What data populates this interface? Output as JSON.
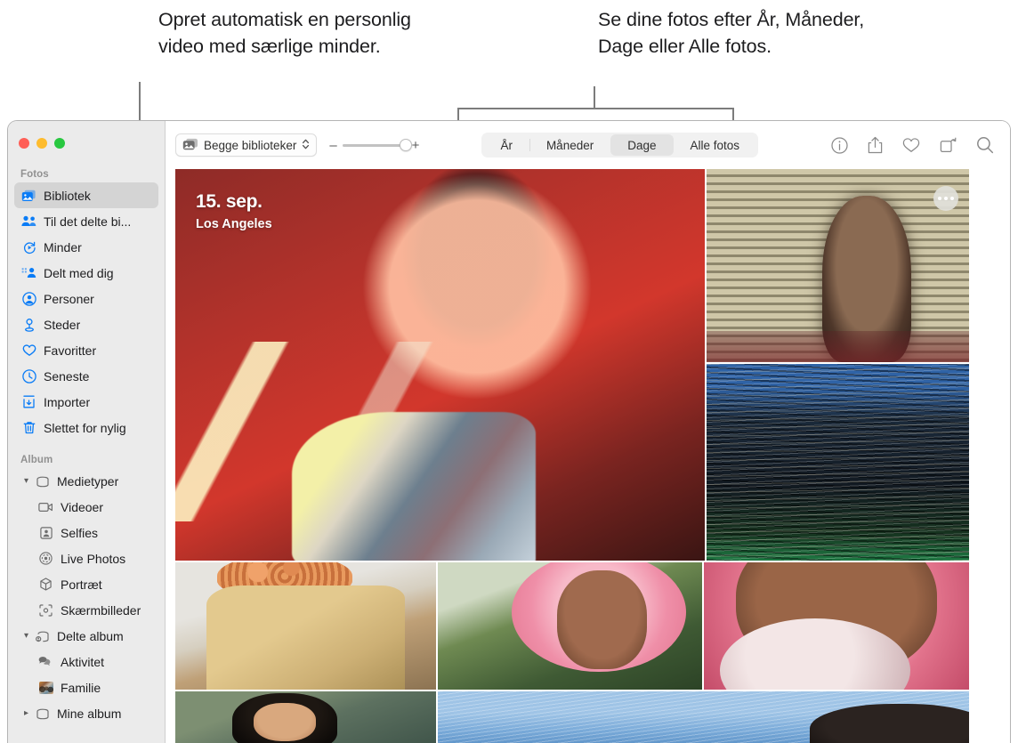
{
  "callouts": {
    "left": "Opret automatisk en personlig video med særlige minder.",
    "right": "Se dine fotos efter År, Måneder, Dage eller Alle fotos."
  },
  "toolbar": {
    "library_button": "Begge biblioteker",
    "zoom_minus": "–",
    "zoom_plus": "+",
    "segments": [
      {
        "label": "År",
        "active": false
      },
      {
        "label": "Måneder",
        "active": false
      },
      {
        "label": "Dage",
        "active": true
      },
      {
        "label": "Alle fotos",
        "active": false
      }
    ],
    "icons": [
      "info-icon",
      "share-icon",
      "heart-icon",
      "rotate-icon",
      "search-icon"
    ]
  },
  "sidebar": {
    "sections": [
      {
        "title": "Fotos",
        "items": [
          {
            "label": "Bibliotek",
            "icon": "library-icon",
            "selected": true
          },
          {
            "label": "Til det delte bi...",
            "icon": "shared-library-icon",
            "selected": false
          },
          {
            "label": "Minder",
            "icon": "memories-icon",
            "selected": false
          },
          {
            "label": "Delt med dig",
            "icon": "shared-with-you-icon",
            "selected": false
          },
          {
            "label": "Personer",
            "icon": "people-icon",
            "selected": false
          },
          {
            "label": "Steder",
            "icon": "places-icon",
            "selected": false
          },
          {
            "label": "Favoritter",
            "icon": "heart-icon",
            "selected": false
          },
          {
            "label": "Seneste",
            "icon": "clock-icon",
            "selected": false
          },
          {
            "label": "Importer",
            "icon": "import-icon",
            "selected": false
          },
          {
            "label": "Slettet for nylig",
            "icon": "trash-icon",
            "selected": false
          }
        ]
      },
      {
        "title": "Album",
        "items": [
          {
            "label": "Medietyper",
            "icon": "folder-icon",
            "disclosure": "open",
            "indent": 0
          },
          {
            "label": "Videoer",
            "icon": "video-icon",
            "indent": 1
          },
          {
            "label": "Selfies",
            "icon": "selfie-icon",
            "indent": 1
          },
          {
            "label": "Live Photos",
            "icon": "live-photo-icon",
            "indent": 1
          },
          {
            "label": "Portræt",
            "icon": "portrait-cube-icon",
            "indent": 1
          },
          {
            "label": "Skærmbilleder",
            "icon": "screenshot-icon",
            "indent": 1
          },
          {
            "label": "Delte album",
            "icon": "shared-folder-icon",
            "disclosure": "open",
            "indent": 0
          },
          {
            "label": "Aktivitet",
            "icon": "activity-icon",
            "indent": 1
          },
          {
            "label": "Familie",
            "icon": "album-thumbnail",
            "indent": 1
          },
          {
            "label": "Mine album",
            "icon": "folder-icon",
            "disclosure": "closed",
            "indent": 0
          }
        ]
      }
    ]
  },
  "grid": {
    "date_overlay": {
      "date": "15. sep.",
      "location": "Los Angeles"
    },
    "more_button": "more-options-button",
    "photos": [
      {
        "name": "photo-red-portrait",
        "art": "p-redportrait"
      },
      {
        "name": "photo-blinds-portrait",
        "art": "p-blinds"
      },
      {
        "name": "photo-forest",
        "art": "p-forest"
      },
      {
        "name": "photo-beads",
        "art": "p-beads"
      },
      {
        "name": "photo-pink-hair",
        "art": "p-pinkhair"
      },
      {
        "name": "photo-bubble-gum",
        "art": "p-bubble"
      },
      {
        "name": "photo-laughing",
        "art": "p-laugh"
      },
      {
        "name": "photo-water",
        "art": "p-water"
      }
    ]
  },
  "window": {
    "traffic_lights": [
      "close-button",
      "minimize-button",
      "zoom-button"
    ]
  }
}
